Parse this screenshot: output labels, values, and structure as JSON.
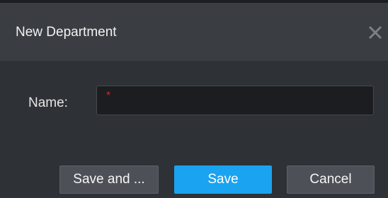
{
  "dialog": {
    "title": "New Department",
    "close_icon": "close-icon"
  },
  "form": {
    "name_label": "Name:",
    "name_value": "",
    "required_marker": "*"
  },
  "buttons": {
    "save_and_label": "Save and ...",
    "save_label": "Save",
    "cancel_label": "Cancel"
  },
  "colors": {
    "background": "#2e3136",
    "titlebar": "#3a3d42",
    "primary": "#1aa3f0",
    "required": "#e02020"
  }
}
